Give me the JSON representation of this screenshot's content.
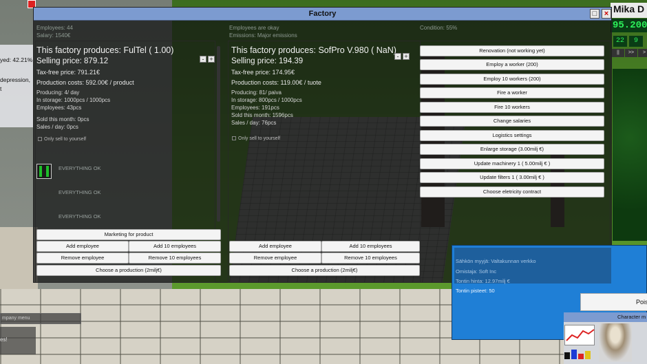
{
  "window": {
    "title": "Factory"
  },
  "header": {
    "employees": "Employees: 44",
    "salary": "Salary: 1540€",
    "employees_status": "Employees are okay",
    "emissions": "Emissions: Major emissions",
    "condition": "Condition: 55%"
  },
  "product1": {
    "name": "This factory produces: FulTel ( 1.00)",
    "selling_price": "Selling price: 879.12",
    "taxfree_price": "Tax-free price: 791.21€",
    "production_costs": "Production costs: 592.00€ / product",
    "producing": "Producing: 4/ day",
    "storage": "In storage: 1000pcs / 1000pcs",
    "employees": "Employees: 43pcs",
    "sold": "Sold this month: 0pcs",
    "sales": "Sales / day: 0pcs",
    "only_sell": "Only sell to yourself",
    "status1": "EVERYTHING OK",
    "status2": "EVERYTHING OK",
    "status3": "EVERYTHING OK",
    "marketing": "Marketing for product",
    "add_employee": "Add employee",
    "add_10": "Add 10 employees",
    "remove_employee": "Remove employee",
    "remove_10": "Remove 10 employees",
    "choose_production": "Choose a production (2milj€)"
  },
  "product2": {
    "name": "This factory produces: SofPro V.980 ( NaN)",
    "selling_price": "Selling price: 194.39",
    "taxfree_price": "Tax-free price: 174.95€",
    "production_costs": "Production costs: 119.00€ / tuote",
    "producing": "Producing: 81/ paiva",
    "storage": "In storage: 800pcs / 1000pcs",
    "employees": "Employees: 191pcs",
    "sold": "Sold this month: 1596pcs",
    "sales": "Sales / day: 76pcs",
    "only_sell": "Only sell to yourself",
    "add_employee": "Add employee",
    "add_10": "Add 10 employees",
    "remove_employee": "Remove employee",
    "remove_10": "Remove 10 employees",
    "choose_production": "Choose a production (2milj€)"
  },
  "stepper": {
    "minus": "-",
    "plus": "+"
  },
  "actions": [
    "Renovation (not working yet)",
    "Employ a worker (200)",
    "Employ 10 workers (200)",
    "Fire a worker",
    "Fire 10 workers",
    "Change salaries",
    "Logistics settings",
    "Enlarge storage (3.00milj €)",
    "Update machinery 1 ( 5.00milj € )",
    "Update filters 1 ( 3.00milj € )",
    "Choose eletricity contract"
  ],
  "hud": {
    "player_name": "Mika D",
    "money": "95.200",
    "num1": "22",
    "num2": "9",
    "ctrl1": "||",
    "ctrl2": ">>",
    "ctrl3": ">"
  },
  "left": {
    "frag1": "yed: 42.21%",
    "frag2": "depression,",
    "frag3": "t",
    "company_menu": "mpany menu",
    "box_text": "es!"
  },
  "plot": {
    "seller": "Sähkön myyjä: Valtakunnan verkko",
    "owner": "Omistaja: Soft Inc",
    "price": "Tontin hinta: 12.97milj €",
    "score": "Tontin pisteet: 50",
    "button": "Pois",
    "character_menu": "Character m"
  },
  "colors": {
    "titlebar": "#7c9bd0",
    "money_text": "#2cf05a",
    "plot_panel": "#1f7fd6"
  }
}
